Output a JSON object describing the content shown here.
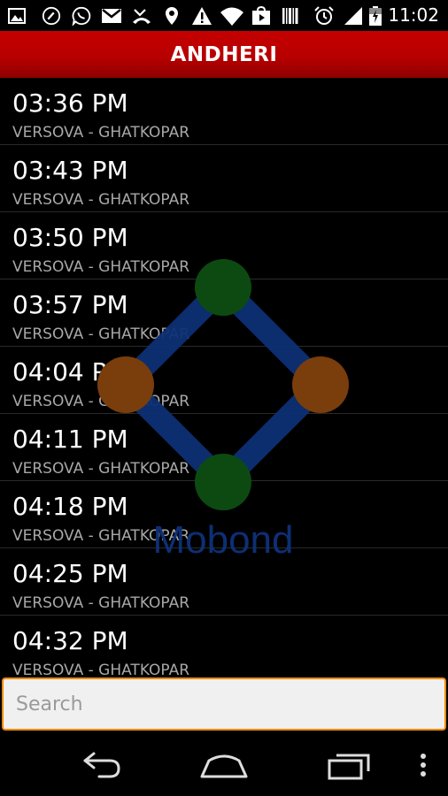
{
  "status_bar": {
    "time": "11:02",
    "icons": [
      "gallery-icon",
      "circle-app-icon",
      "whatsapp-icon",
      "gmail-icon",
      "missed-call-icon",
      "location-icon",
      "warning-icon",
      "wifi-icon",
      "play-store-icon",
      "barcode-icon",
      "alarm-icon",
      "signal-icon",
      "battery-icon"
    ]
  },
  "action_bar": {
    "title": "ANDHERI"
  },
  "list": {
    "items": [
      {
        "time": "03:36 PM",
        "route": "VERSOVA - GHATKOPAR"
      },
      {
        "time": "03:43 PM",
        "route": "VERSOVA - GHATKOPAR"
      },
      {
        "time": "03:50 PM",
        "route": "VERSOVA - GHATKOPAR"
      },
      {
        "time": "03:57 PM",
        "route": "VERSOVA - GHATKOPAR"
      },
      {
        "time": "04:04 PM",
        "route": "VERSOVA - GHATKOPAR"
      },
      {
        "time": "04:11 PM",
        "route": "VERSOVA - GHATKOPAR"
      },
      {
        "time": "04:18 PM",
        "route": "VERSOVA - GHATKOPAR"
      },
      {
        "time": "04:25 PM",
        "route": "VERSOVA - GHATKOPAR"
      },
      {
        "time": "04:32 PM",
        "route": "VERSOVA - GHATKOPAR"
      }
    ]
  },
  "watermark": {
    "text": "Mobond"
  },
  "search": {
    "placeholder": "Search",
    "value": ""
  },
  "nav_bar": {
    "icons": [
      "back-icon",
      "home-icon",
      "recents-icon",
      "overflow-menu-icon"
    ]
  },
  "colors": {
    "action_bar": "#b80000",
    "search_border": "#f08a00",
    "route_text": "#a8a8a8",
    "watermark_blue": "#0d2f74",
    "watermark_green": "#0c4a12",
    "watermark_orange": "#7a3d0c"
  }
}
